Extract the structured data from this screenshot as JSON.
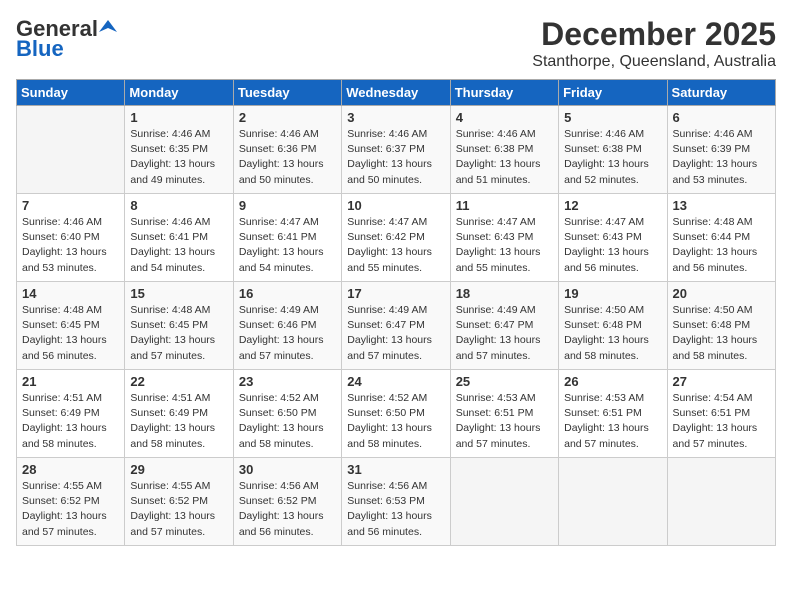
{
  "logo": {
    "general": "General",
    "blue": "Blue"
  },
  "title": "December 2025",
  "subtitle": "Stanthorpe, Queensland, Australia",
  "days_of_week": [
    "Sunday",
    "Monday",
    "Tuesday",
    "Wednesday",
    "Thursday",
    "Friday",
    "Saturday"
  ],
  "weeks": [
    [
      {
        "day": "",
        "info": ""
      },
      {
        "day": "1",
        "info": "Sunrise: 4:46 AM\nSunset: 6:35 PM\nDaylight: 13 hours\nand 49 minutes."
      },
      {
        "day": "2",
        "info": "Sunrise: 4:46 AM\nSunset: 6:36 PM\nDaylight: 13 hours\nand 50 minutes."
      },
      {
        "day": "3",
        "info": "Sunrise: 4:46 AM\nSunset: 6:37 PM\nDaylight: 13 hours\nand 50 minutes."
      },
      {
        "day": "4",
        "info": "Sunrise: 4:46 AM\nSunset: 6:38 PM\nDaylight: 13 hours\nand 51 minutes."
      },
      {
        "day": "5",
        "info": "Sunrise: 4:46 AM\nSunset: 6:38 PM\nDaylight: 13 hours\nand 52 minutes."
      },
      {
        "day": "6",
        "info": "Sunrise: 4:46 AM\nSunset: 6:39 PM\nDaylight: 13 hours\nand 53 minutes."
      }
    ],
    [
      {
        "day": "7",
        "info": "Sunrise: 4:46 AM\nSunset: 6:40 PM\nDaylight: 13 hours\nand 53 minutes."
      },
      {
        "day": "8",
        "info": "Sunrise: 4:46 AM\nSunset: 6:41 PM\nDaylight: 13 hours\nand 54 minutes."
      },
      {
        "day": "9",
        "info": "Sunrise: 4:47 AM\nSunset: 6:41 PM\nDaylight: 13 hours\nand 54 minutes."
      },
      {
        "day": "10",
        "info": "Sunrise: 4:47 AM\nSunset: 6:42 PM\nDaylight: 13 hours\nand 55 minutes."
      },
      {
        "day": "11",
        "info": "Sunrise: 4:47 AM\nSunset: 6:43 PM\nDaylight: 13 hours\nand 55 minutes."
      },
      {
        "day": "12",
        "info": "Sunrise: 4:47 AM\nSunset: 6:43 PM\nDaylight: 13 hours\nand 56 minutes."
      },
      {
        "day": "13",
        "info": "Sunrise: 4:48 AM\nSunset: 6:44 PM\nDaylight: 13 hours\nand 56 minutes."
      }
    ],
    [
      {
        "day": "14",
        "info": "Sunrise: 4:48 AM\nSunset: 6:45 PM\nDaylight: 13 hours\nand 56 minutes."
      },
      {
        "day": "15",
        "info": "Sunrise: 4:48 AM\nSunset: 6:45 PM\nDaylight: 13 hours\nand 57 minutes."
      },
      {
        "day": "16",
        "info": "Sunrise: 4:49 AM\nSunset: 6:46 PM\nDaylight: 13 hours\nand 57 minutes."
      },
      {
        "day": "17",
        "info": "Sunrise: 4:49 AM\nSunset: 6:47 PM\nDaylight: 13 hours\nand 57 minutes."
      },
      {
        "day": "18",
        "info": "Sunrise: 4:49 AM\nSunset: 6:47 PM\nDaylight: 13 hours\nand 57 minutes."
      },
      {
        "day": "19",
        "info": "Sunrise: 4:50 AM\nSunset: 6:48 PM\nDaylight: 13 hours\nand 58 minutes."
      },
      {
        "day": "20",
        "info": "Sunrise: 4:50 AM\nSunset: 6:48 PM\nDaylight: 13 hours\nand 58 minutes."
      }
    ],
    [
      {
        "day": "21",
        "info": "Sunrise: 4:51 AM\nSunset: 6:49 PM\nDaylight: 13 hours\nand 58 minutes."
      },
      {
        "day": "22",
        "info": "Sunrise: 4:51 AM\nSunset: 6:49 PM\nDaylight: 13 hours\nand 58 minutes."
      },
      {
        "day": "23",
        "info": "Sunrise: 4:52 AM\nSunset: 6:50 PM\nDaylight: 13 hours\nand 58 minutes."
      },
      {
        "day": "24",
        "info": "Sunrise: 4:52 AM\nSunset: 6:50 PM\nDaylight: 13 hours\nand 58 minutes."
      },
      {
        "day": "25",
        "info": "Sunrise: 4:53 AM\nSunset: 6:51 PM\nDaylight: 13 hours\nand 57 minutes."
      },
      {
        "day": "26",
        "info": "Sunrise: 4:53 AM\nSunset: 6:51 PM\nDaylight: 13 hours\nand 57 minutes."
      },
      {
        "day": "27",
        "info": "Sunrise: 4:54 AM\nSunset: 6:51 PM\nDaylight: 13 hours\nand 57 minutes."
      }
    ],
    [
      {
        "day": "28",
        "info": "Sunrise: 4:55 AM\nSunset: 6:52 PM\nDaylight: 13 hours\nand 57 minutes."
      },
      {
        "day": "29",
        "info": "Sunrise: 4:55 AM\nSunset: 6:52 PM\nDaylight: 13 hours\nand 57 minutes."
      },
      {
        "day": "30",
        "info": "Sunrise: 4:56 AM\nSunset: 6:52 PM\nDaylight: 13 hours\nand 56 minutes."
      },
      {
        "day": "31",
        "info": "Sunrise: 4:56 AM\nSunset: 6:53 PM\nDaylight: 13 hours\nand 56 minutes."
      },
      {
        "day": "",
        "info": ""
      },
      {
        "day": "",
        "info": ""
      },
      {
        "day": "",
        "info": ""
      }
    ]
  ]
}
